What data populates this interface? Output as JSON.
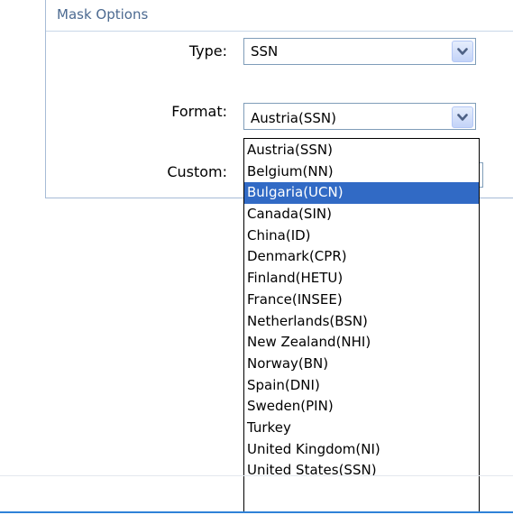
{
  "panel": {
    "title": "Mask Options"
  },
  "fields": {
    "type_label": "Type:",
    "type_value": "SSN",
    "format_label": "Format:",
    "format_value": "Austria(SSN)",
    "custom_label": "Custom:"
  },
  "dropdown": {
    "selected_index": 2,
    "options": [
      "Austria(SSN)",
      "Belgium(NN)",
      "Bulgaria(UCN)",
      "Canada(SIN)",
      "China(ID)",
      "Denmark(CPR)",
      "Finland(HETU)",
      "France(INSEE)",
      "Netherlands(BSN)",
      "New Zealand(NHI)",
      "Norway(BN)",
      "Spain(DNI)",
      "Sweden(PIN)",
      "Turkey",
      "United Kingdom(NI)",
      "United States(SSN)"
    ]
  },
  "colors": {
    "selection": "#316ac5",
    "panel_title": "#4c6a91",
    "accent_line": "#2f82d8"
  },
  "icons": {
    "combo_button": "chevron-down-icon"
  }
}
